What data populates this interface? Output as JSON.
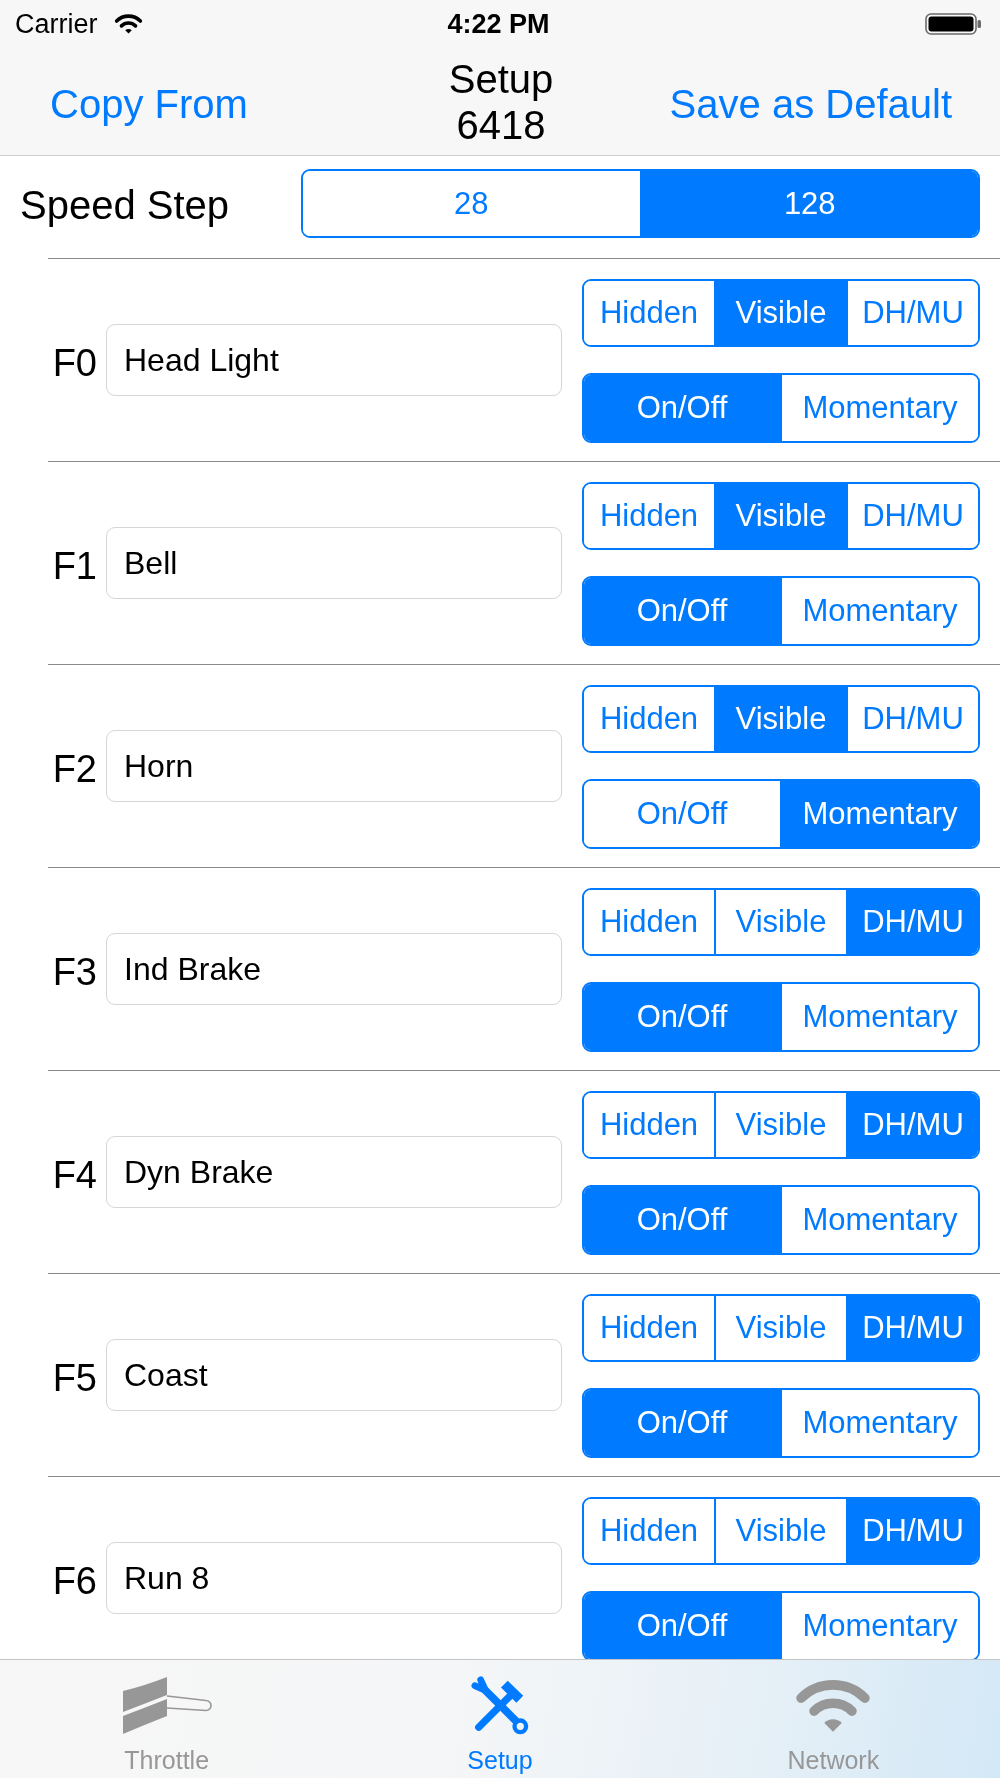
{
  "status_bar": {
    "carrier": "Carrier",
    "time": "4:22 PM"
  },
  "nav_bar": {
    "left_button": "Copy From",
    "title": "Setup",
    "subtitle": "6418",
    "right_button": "Save as Default"
  },
  "speed_step": {
    "label": "Speed Step",
    "options": [
      {
        "label": "28",
        "selected": false
      },
      {
        "label": "128",
        "selected": true
      }
    ]
  },
  "functions": [
    {
      "label": "F0",
      "value": "Head Light",
      "visibility": [
        {
          "label": "Hidden",
          "selected": false
        },
        {
          "label": "Visible",
          "selected": true
        },
        {
          "label": "DH/MU",
          "selected": false
        }
      ],
      "mode": [
        {
          "label": "On/Off",
          "selected": true
        },
        {
          "label": "Momentary",
          "selected": false
        }
      ]
    },
    {
      "label": "F1",
      "value": "Bell",
      "visibility": [
        {
          "label": "Hidden",
          "selected": false
        },
        {
          "label": "Visible",
          "selected": true
        },
        {
          "label": "DH/MU",
          "selected": false
        }
      ],
      "mode": [
        {
          "label": "On/Off",
          "selected": true
        },
        {
          "label": "Momentary",
          "selected": false
        }
      ]
    },
    {
      "label": "F2",
      "value": "Horn",
      "visibility": [
        {
          "label": "Hidden",
          "selected": false
        },
        {
          "label": "Visible",
          "selected": true
        },
        {
          "label": "DH/MU",
          "selected": false
        }
      ],
      "mode": [
        {
          "label": "On/Off",
          "selected": false
        },
        {
          "label": "Momentary",
          "selected": true
        }
      ]
    },
    {
      "label": "F3",
      "value": "Ind Brake",
      "visibility": [
        {
          "label": "Hidden",
          "selected": false
        },
        {
          "label": "Visible",
          "selected": false
        },
        {
          "label": "DH/MU",
          "selected": true
        }
      ],
      "mode": [
        {
          "label": "On/Off",
          "selected": true
        },
        {
          "label": "Momentary",
          "selected": false
        }
      ]
    },
    {
      "label": "F4",
      "value": "Dyn Brake",
      "visibility": [
        {
          "label": "Hidden",
          "selected": false
        },
        {
          "label": "Visible",
          "selected": false
        },
        {
          "label": "DH/MU",
          "selected": true
        }
      ],
      "mode": [
        {
          "label": "On/Off",
          "selected": true
        },
        {
          "label": "Momentary",
          "selected": false
        }
      ]
    },
    {
      "label": "F5",
      "value": "Coast",
      "visibility": [
        {
          "label": "Hidden",
          "selected": false
        },
        {
          "label": "Visible",
          "selected": false
        },
        {
          "label": "DH/MU",
          "selected": true
        }
      ],
      "mode": [
        {
          "label": "On/Off",
          "selected": true
        },
        {
          "label": "Momentary",
          "selected": false
        }
      ]
    },
    {
      "label": "F6",
      "value": "Run 8",
      "visibility": [
        {
          "label": "Hidden",
          "selected": false
        },
        {
          "label": "Visible",
          "selected": false
        },
        {
          "label": "DH/MU",
          "selected": true
        }
      ],
      "mode": [
        {
          "label": "On/Off",
          "selected": true
        },
        {
          "label": "Momentary",
          "selected": false
        }
      ]
    }
  ],
  "tab_bar": [
    {
      "kind": "throttle",
      "label": "Throttle",
      "selected": false
    },
    {
      "kind": "setup",
      "label": "Setup",
      "selected": true
    },
    {
      "kind": "network",
      "label": "Network",
      "selected": false
    }
  ]
}
